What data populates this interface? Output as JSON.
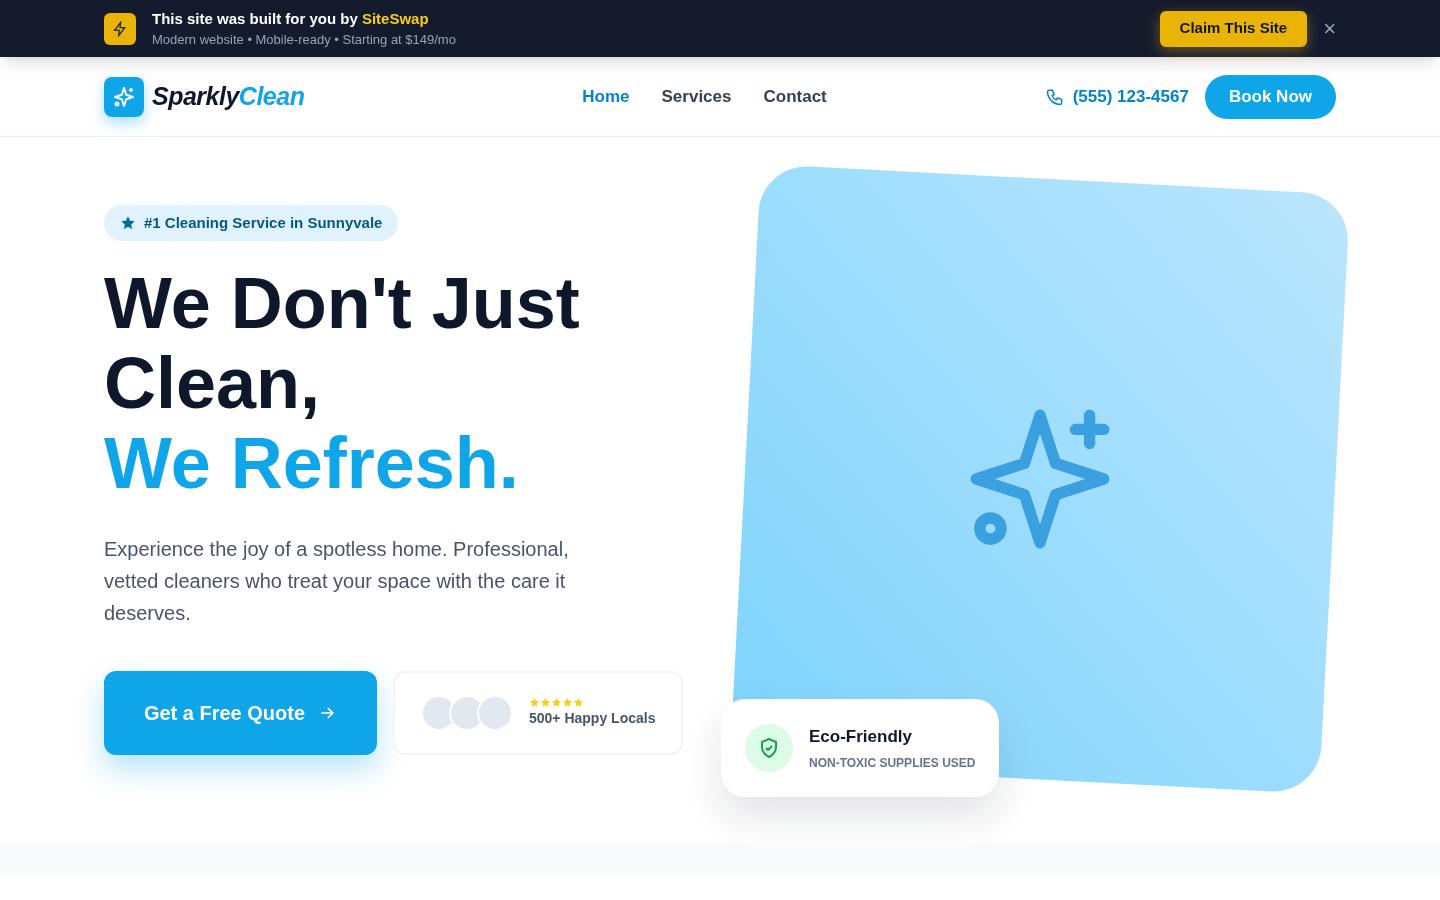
{
  "promo_bar": {
    "title": "This site was built for you by",
    "brand": "SiteSwap",
    "subtitle": "Modern website • Mobile-ready • Starting at $149/mo",
    "button": "Claim This Site",
    "close": "×"
  },
  "header": {
    "logo_first": "Sparkly",
    "logo_second": "Clean",
    "nav": [
      {
        "label": "Home",
        "selected": true
      },
      {
        "label": "Services",
        "selected": false
      },
      {
        "label": "Contact",
        "selected": false
      }
    ],
    "phone": "(555) 123-4567",
    "button": "Book Now"
  },
  "hero": {
    "badge": "#1 Cleaning Service in Sunnyvale",
    "headline": "We Don't Just Clean,",
    "headline_accent": "We Refresh.",
    "description": "Experience the joy of a spotless home. Professional, vetted cleaners who treat your space with the care it deserves.",
    "cta": "Get a Free Quote",
    "social_proof": {
      "stars": 5,
      "label": "500+ Happy Locals"
    },
    "feature_card": {
      "title": "Eco-Friendly",
      "subtitle": "NON-TOXIC SUPPLIES USED"
    }
  }
}
